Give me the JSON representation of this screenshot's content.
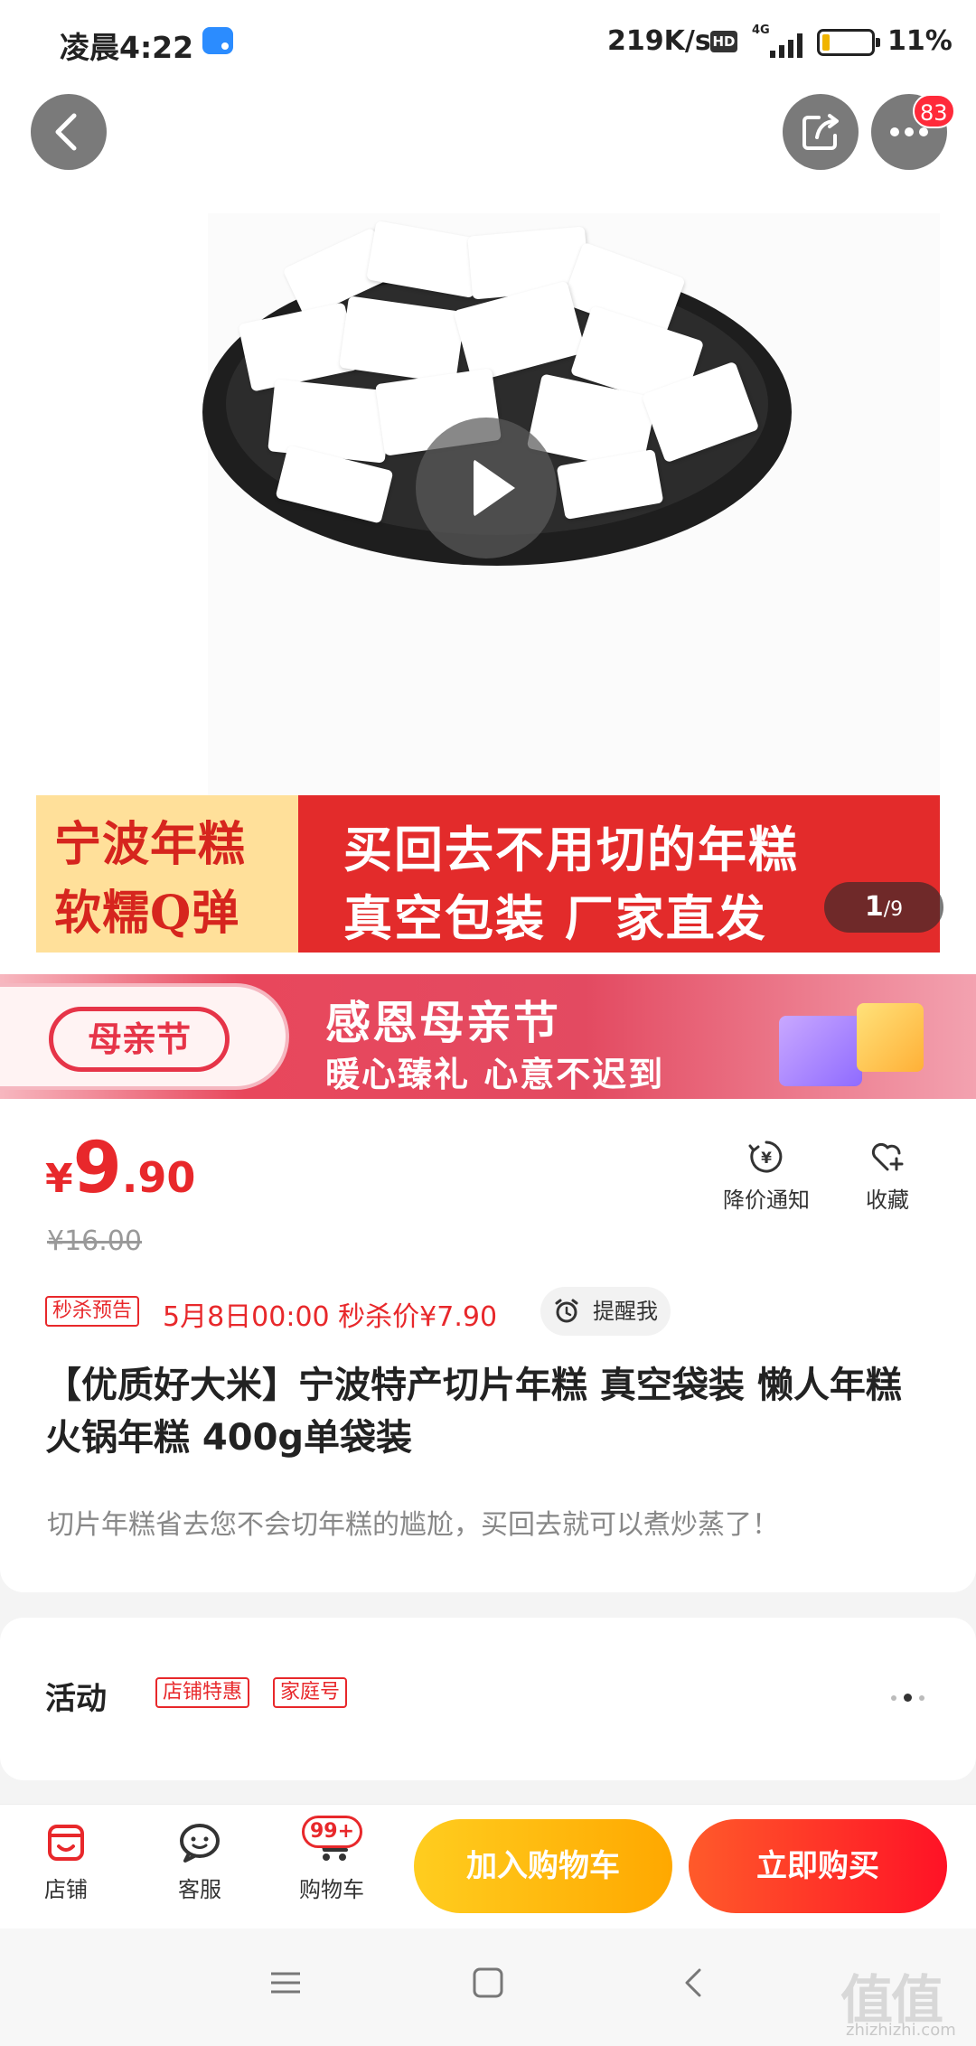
{
  "status_bar": {
    "time": "凌晨4:22",
    "speed": "219K/s",
    "hd": "HD",
    "network": "4G",
    "battery": "11%",
    "battery_level": 0.11
  },
  "top_actions": {
    "more_badge": "83"
  },
  "gallery": {
    "banner_left_line1": "宁波年糕",
    "banner_left_line2": "软糯Q弹",
    "banner_right_line1": "买回去不用切的年糕",
    "banner_right_line2": "真空包装 厂家直发",
    "counter_current": "1",
    "counter_total": "/9"
  },
  "promo_banner": {
    "logo": "母亲节",
    "title": "感恩母亲节",
    "subtitle": "暖心臻礼 心意不迟到"
  },
  "product": {
    "price_symbol": "¥",
    "price_int": "9",
    "price_dec": ".90",
    "original_price": "¥16.00",
    "flash_tag": "秒杀预告",
    "flash_text": "5月8日00:00 秒杀价¥7.90",
    "remind_label": "提醒我",
    "price_alert_label": "降价通知",
    "favorite_label": "收藏",
    "title": "【优质好大米】宁波特产切片年糕 真空袋装 懒人年糕 火锅年糕 400g单袋装",
    "description": "切片年糕省去您不会切年糕的尴尬，买回去就可以煮炒蒸了！"
  },
  "activity": {
    "label": "活动",
    "tags": [
      "店铺特惠",
      "家庭号"
    ]
  },
  "bottom_bar": {
    "shop_label": "店铺",
    "service_label": "客服",
    "cart_label": "购物车",
    "cart_badge": "99+",
    "add_to_cart": "加入购物车",
    "buy_now": "立即购买"
  },
  "watermark": {
    "text": "值值值",
    "sub": "zhizhizhi.com"
  },
  "colors": {
    "accent": "#e8282b",
    "cart_button": "#ffb300",
    "buy_button": "#ff1f2b"
  },
  "icons": [
    "back-icon",
    "share-icon",
    "more-icon",
    "play-icon",
    "price-alert-icon",
    "heart-plus-icon",
    "alarm-icon",
    "shop-icon",
    "chat-icon",
    "cart-icon",
    "menu-icon",
    "home-icon",
    "back-nav-icon"
  ]
}
